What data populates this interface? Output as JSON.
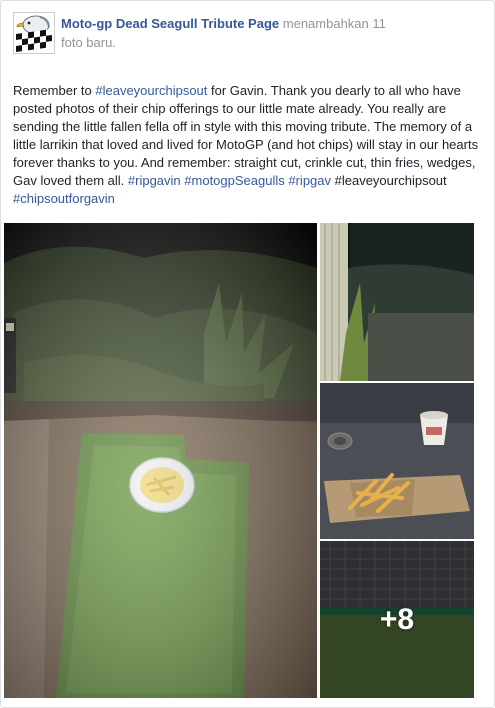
{
  "post": {
    "author": "Moto-gp Dead Seagull Tribute Page",
    "action_text": "menambahkan 11",
    "action_text_line2": "foto baru.",
    "body": {
      "t1": "Remember to ",
      "h1": "#leaveyourchipsout",
      "t2": " for Gavin. Thank you dearly to all who have posted photos of their chip offerings to our little mate already. You really are sending the little fallen fella off in style with this moving tribute. The memory of a little larrikin that loved and lived for MotoGP (and hot chips) will stay in our hearts forever thanks to you. And remember: straight cut, crinkle cut, thin fries, wedges, Gav loved them all. ",
      "h2": "#ripgavin",
      "t3": " ",
      "h3": "#motogpSeagulls",
      "t4": " ",
      "h4": "#ripgav",
      "t5": " #leaveyourchipsout ",
      "h5": "#chipsoutforgavin"
    },
    "more_photos": "+8"
  },
  "colors": {
    "link": "#365899",
    "meta": "#90949c",
    "text": "#1d2129"
  }
}
